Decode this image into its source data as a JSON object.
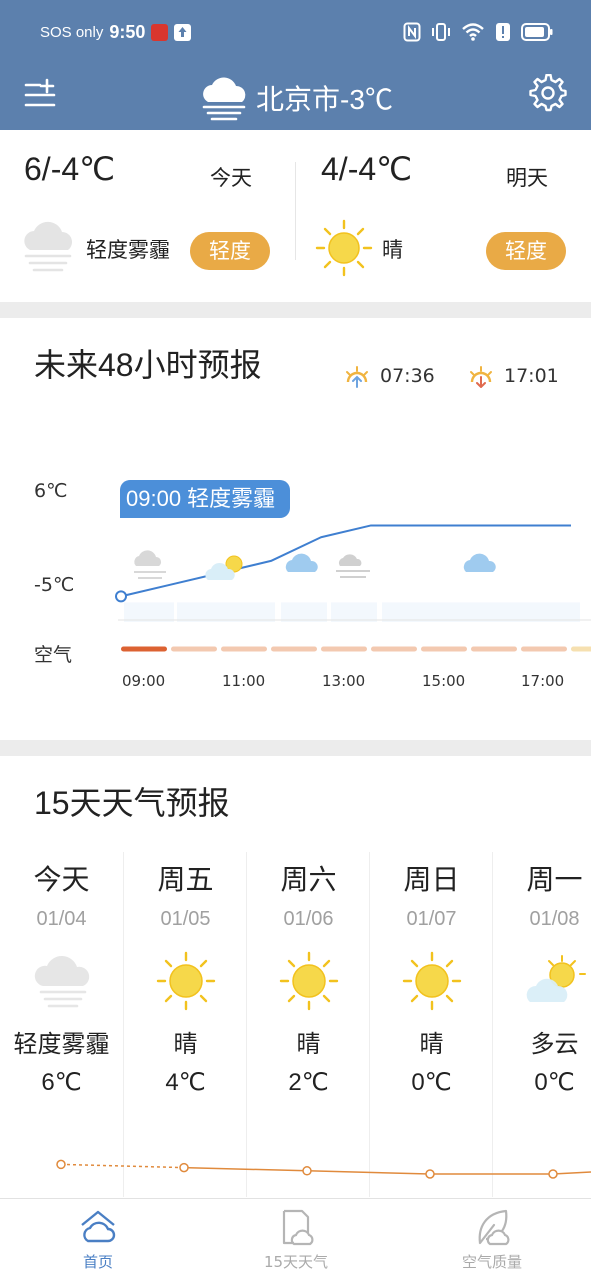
{
  "status_bar": {
    "carrier": "SOS only",
    "time": "9:50"
  },
  "header": {
    "title": "北京市-3℃",
    "icons": [
      "menu-plus-icon",
      "haze-cloud-icon",
      "gear-icon"
    ]
  },
  "today": {
    "temp": "6/-4℃",
    "label": "今天",
    "condition": "轻度雾霾",
    "aqi": "轻度",
    "icon": "haze-cloud-icon"
  },
  "tomorrow": {
    "temp": "4/-4℃",
    "label": "明天",
    "condition": "晴",
    "aqi": "轻度",
    "icon": "sun-icon"
  },
  "forecast48": {
    "title": "未来48小时预报",
    "sunrise": "07:36",
    "sunset": "17:01",
    "y_max_label": "6℃",
    "y_min_label": "-5℃",
    "air_label": "空气",
    "tooltip": "09:00 轻度雾霾",
    "hours": [
      "09:00",
      "11:00",
      "13:00",
      "15:00",
      "17:00"
    ],
    "colors": {
      "line": "#3f7fd0",
      "air_bad": "#dc6232",
      "air_light": "#f3c9b0",
      "air_last": "#f6e0b0"
    }
  },
  "chart_data": {
    "type": "line",
    "x": [
      "09:00",
      "10:00",
      "11:00",
      "12:00",
      "13:00",
      "14:00",
      "15:00",
      "16:00",
      "17:00",
      "18:00"
    ],
    "values": [
      -3,
      -2,
      -1,
      0,
      2,
      3,
      3,
      3,
      3,
      3
    ],
    "ylim": [
      -5,
      6
    ],
    "ylabel": ""
  },
  "forecast15": {
    "title": "15天天气预报",
    "days": [
      {
        "weekday": "今天",
        "date": "01/04",
        "condition": "轻度雾霾",
        "temp": "6℃",
        "icon": "haze-cloud-icon",
        "high": 6
      },
      {
        "weekday": "周五",
        "date": "01/05",
        "condition": "晴",
        "temp": "4℃",
        "icon": "sun-icon",
        "high": 4
      },
      {
        "weekday": "周六",
        "date": "01/06",
        "condition": "晴",
        "temp": "2℃",
        "icon": "sun-icon",
        "high": 2
      },
      {
        "weekday": "周日",
        "date": "01/07",
        "condition": "晴",
        "temp": "0℃",
        "icon": "sun-icon",
        "high": 0
      },
      {
        "weekday": "周一",
        "date": "01/08",
        "condition": "多云",
        "temp": "0℃",
        "icon": "partly-cloudy-icon",
        "high": 0
      }
    ]
  },
  "nav": {
    "items": [
      {
        "label": "首页",
        "icon": "home-icon",
        "active": true
      },
      {
        "label": "15天天气",
        "icon": "calendar-cloud-icon",
        "active": false
      },
      {
        "label": "空气质量",
        "icon": "leaf-icon",
        "active": false
      }
    ]
  },
  "colors": {
    "header_bg": "#5c80ad",
    "badge": "#e9aa46",
    "active_nav": "#4a7fc4",
    "trend_line": "#e08a3c"
  }
}
